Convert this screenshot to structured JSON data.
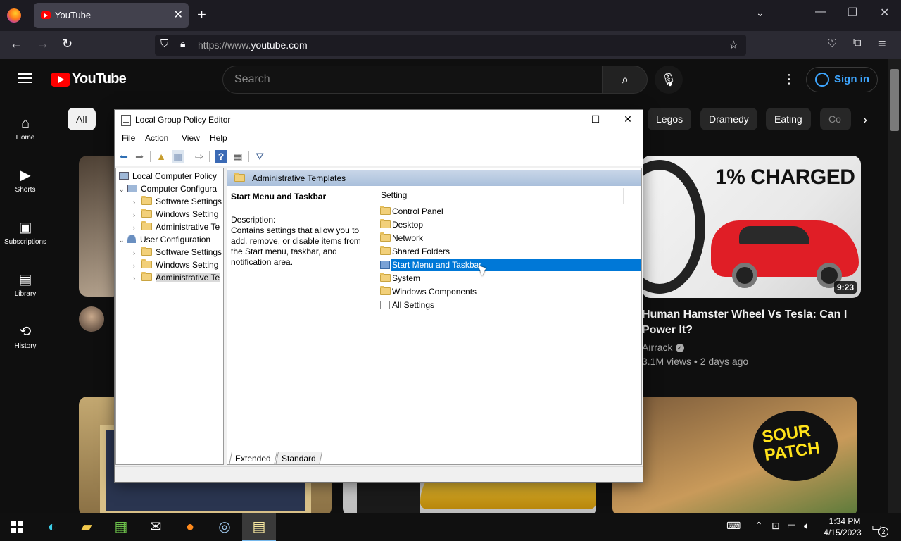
{
  "browser": {
    "tab_title": "YouTube",
    "tab_close": "✕",
    "new_tab": "+",
    "url_prefix": "https://www.",
    "url_domain": "youtube.com"
  },
  "youtube": {
    "logo": "YouTube",
    "search_placeholder": "Search",
    "sign_in": "Sign in",
    "sidebar": [
      {
        "label": "Home",
        "icon": "home-icon"
      },
      {
        "label": "Shorts",
        "icon": "shorts-icon"
      },
      {
        "label": "Subscriptions",
        "icon": "subscriptions-icon"
      },
      {
        "label": "Library",
        "icon": "library-icon"
      },
      {
        "label": "History",
        "icon": "history-icon"
      }
    ],
    "chips": [
      "All",
      "Legos",
      "Dramedy",
      "Eating",
      "Co"
    ],
    "video": {
      "thumb_caption": "1% CHARGED",
      "duration": "9:23",
      "title": "Human Hamster Wheel Vs Tesla: Can I Power It?",
      "channel": "Airrack",
      "meta": "3.1M views • 2 days ago"
    },
    "bottom_thumb_text": "SOUR PATCH"
  },
  "gpedit": {
    "title": "Local Group Policy Editor",
    "menu": [
      "File",
      "Action",
      "View",
      "Help"
    ],
    "tree": [
      {
        "label": "Local Computer Policy",
        "indent": 0,
        "icon": "pc",
        "exp": ""
      },
      {
        "label": "Computer Configura",
        "indent": 1,
        "icon": "pc",
        "exp": "⌄"
      },
      {
        "label": "Software Settings",
        "indent": 2,
        "icon": "folder",
        "exp": "›"
      },
      {
        "label": "Windows Setting",
        "indent": 2,
        "icon": "folder",
        "exp": "›"
      },
      {
        "label": "Administrative Te",
        "indent": 2,
        "icon": "folder",
        "exp": "›"
      },
      {
        "label": "User Configuration",
        "indent": 1,
        "icon": "user",
        "exp": "⌄"
      },
      {
        "label": "Software Settings",
        "indent": 2,
        "icon": "folder",
        "exp": "›"
      },
      {
        "label": "Windows Setting",
        "indent": 2,
        "icon": "folder",
        "exp": "›"
      },
      {
        "label": "Administrative Te",
        "indent": 2,
        "icon": "folder",
        "exp": "›",
        "selected": true
      }
    ],
    "header": "Administrative Templates",
    "desc_title": "Start Menu and Taskbar",
    "desc_label": "Description:",
    "desc_text": "Contains settings that allow you to add, remove, or disable items from the Start menu, taskbar, and notification area.",
    "column": "Setting",
    "settings": [
      {
        "label": "Control Panel",
        "icon": "folder"
      },
      {
        "label": "Desktop",
        "icon": "folder"
      },
      {
        "label": "Network",
        "icon": "folder"
      },
      {
        "label": "Shared Folders",
        "icon": "folder"
      },
      {
        "label": "Start Menu and Taskbar",
        "icon": "item",
        "selected": true
      },
      {
        "label": "System",
        "icon": "folder"
      },
      {
        "label": "Windows Components",
        "icon": "folder"
      },
      {
        "label": "All Settings",
        "icon": "all"
      }
    ],
    "tabs": [
      "Extended",
      "Standard"
    ]
  },
  "taskbar": {
    "time": "1:34 PM",
    "date": "4/15/2023",
    "notifications": "2"
  }
}
